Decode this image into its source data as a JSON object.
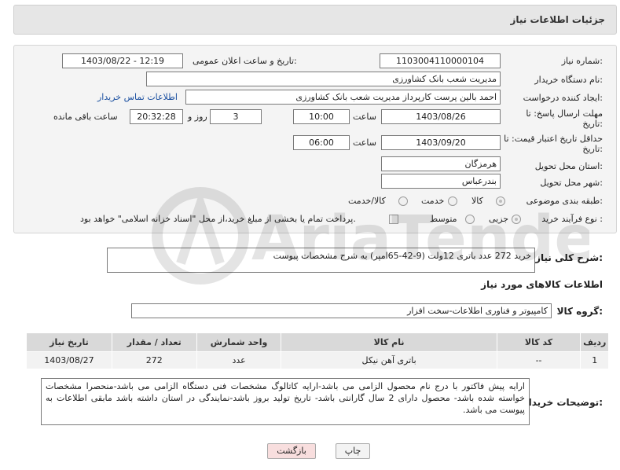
{
  "header": {
    "title": "جزئیات اطلاعات نیاز"
  },
  "form": {
    "need_number_label": "شماره نیاز:",
    "need_number": "1103004110000104",
    "announce_label": "تاریخ و ساعت اعلان عمومی:",
    "announce_value": "1403/08/22 - 12:19",
    "buyer_org_label": "نام دستگاه خریدار:",
    "buyer_org": "مدیریت شعب بانک کشاورزی",
    "creator_label": "ایجاد کننده درخواست:",
    "creator": "احمد بالین پرست  کارپرداز مدیریت شعب بانک کشاورزی",
    "buyer_contact_link": "اطلاعات تماس خریدار",
    "deadline_label_1": "مهلت ارسال پاسخ: تا",
    "deadline_label_2": "تاریخ:",
    "deadline_date": "1403/08/26",
    "time_label": "ساعت",
    "deadline_time": "10:00",
    "days_count": "3",
    "days_word": "روز و",
    "remaining_time": "20:32:28",
    "remaining_label": "ساعت باقی مانده",
    "validity_label_1": "حداقل تاریخ اعتبار قیمت: تا",
    "validity_label_2": "تاریخ:",
    "validity_date": "1403/09/20",
    "validity_time": "06:00",
    "province_label": "استان محل تحویل:",
    "province": "هرمزگان",
    "city_label": "شهر محل تحویل:",
    "city": "بندرعباس",
    "category_label": "طبقه بندی موضوعی:",
    "category_options": [
      "کالا",
      "خدمت",
      "کالا/خدمت"
    ],
    "process_label": "نوع فرآیند خرید :",
    "process_options": [
      "جزیی",
      "متوسط"
    ],
    "payment_note": "پرداخت تمام یا بخشی از مبلغ خرید،از محل \"اسناد خزانه اسلامی\" خواهد بود."
  },
  "summary": {
    "label": "شرح کلی نیاز:",
    "text": "خرید 272 عدد باتری 12ولت (9-42-65امپر) به شرح مشخصات پیوست"
  },
  "goods": {
    "section_title": "اطلاعات کالاهای مورد نیاز",
    "group_label": "گروه کالا:",
    "group_value": "کامپیوتر و فناوری اطلاعات-سخت افزار",
    "columns": [
      "ردیف",
      "کد کالا",
      "نام کالا",
      "واحد شمارش",
      "تعداد / مقدار",
      "تاریخ نیاز"
    ],
    "rows": [
      {
        "row": "1",
        "code": "--",
        "name": "باتری آهن نیکل",
        "unit": "عدد",
        "qty": "272",
        "date": "1403/08/27"
      }
    ]
  },
  "buyer_notes": {
    "label": "توضیحات خریدار:",
    "text": "ارایه پیش فاکتور با درج نام محصول الزامی می باشد-ارایه کاتالوگ مشخصات فنی دستگاه الزامی می باشد-منحصرا مشخصات خواسته شده باشد- محصول دارای 2 سال گارانتی باشد- تاریخ تولید بروز باشد-نمایندگی در استان داشته باشد مابقی اطلاعات به پیوست می باشد."
  },
  "buttons": {
    "print": "چاپ",
    "back": "بازگشت"
  },
  "colors": {
    "back_button_bg": "#f8dede",
    "print_button_bg": "#f3f3f3",
    "link": "#1a4fa0"
  },
  "watermark": {
    "text": "AriaTender.neT"
  }
}
